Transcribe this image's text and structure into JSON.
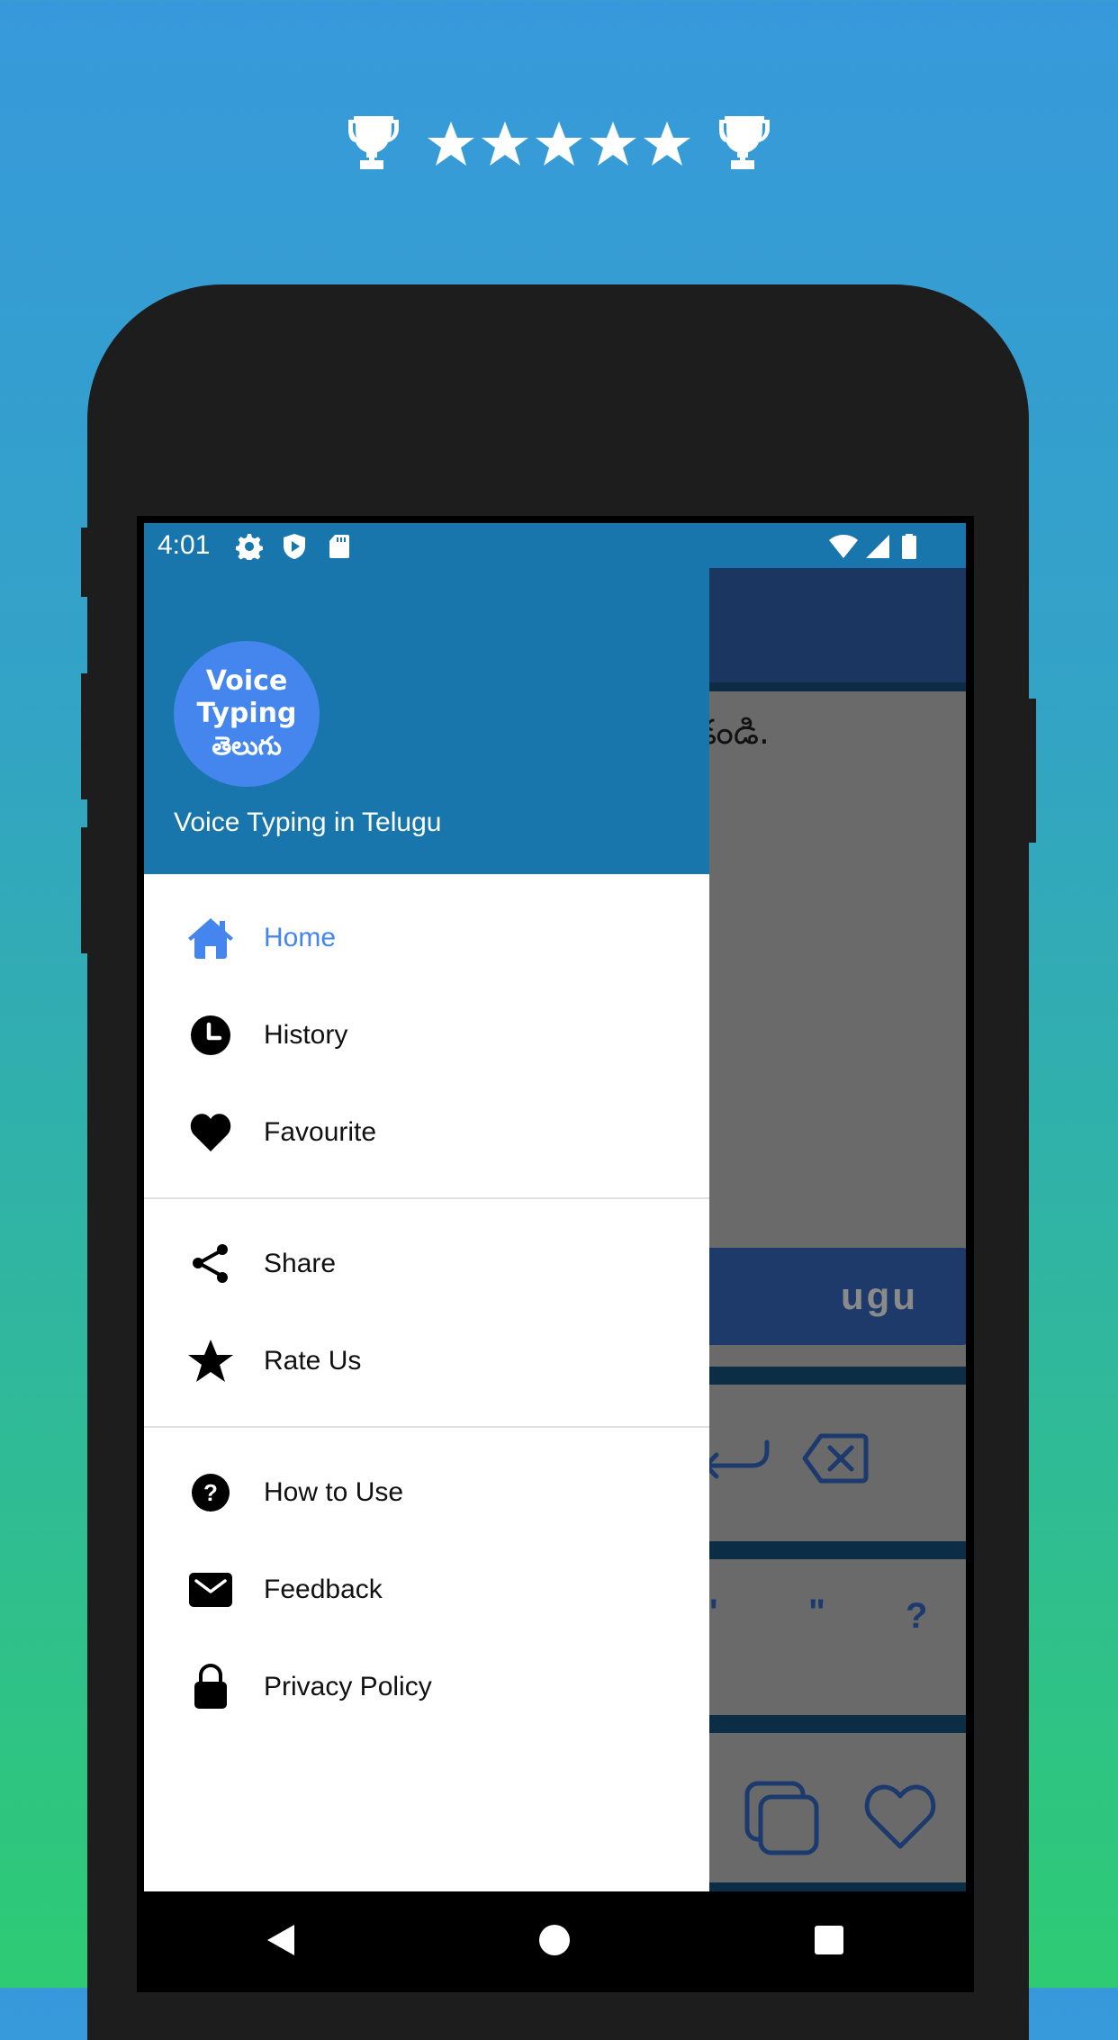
{
  "promo": {
    "rating_stars": 5,
    "left_icon": "trophy-icon",
    "right_icon": "trophy-icon"
  },
  "status_bar": {
    "time": "4:01",
    "left_icons": [
      "gear-icon",
      "shield-play-icon",
      "sd-card-icon"
    ],
    "right_icons": [
      "wifi-icon",
      "cell-signal-icon",
      "battery-icon"
    ]
  },
  "drawer": {
    "logo": {
      "line1": "Voice",
      "line2": "Typing",
      "line3": "తెలుగు"
    },
    "title": "Voice Typing in Telugu",
    "groups": [
      [
        {
          "label": "Home",
          "icon": "home-icon",
          "active": true
        },
        {
          "label": "History",
          "icon": "clock-icon",
          "active": false
        },
        {
          "label": "Favourite",
          "icon": "heart-icon",
          "active": false
        }
      ],
      [
        {
          "label": "Share",
          "icon": "share-icon",
          "active": false
        },
        {
          "label": "Rate Us",
          "icon": "star-icon",
          "active": false
        }
      ],
      [
        {
          "label": "How to Use",
          "icon": "help-circle-icon",
          "active": false
        },
        {
          "label": "Feedback",
          "icon": "mail-icon",
          "active": false
        },
        {
          "label": "Privacy Policy",
          "icon": "lock-icon",
          "active": false
        }
      ]
    ]
  },
  "background_app": {
    "text_fragment": "డండి.",
    "button_fragment": "ugu",
    "keys": [
      "'",
      "\"",
      "?"
    ]
  },
  "colors": {
    "accent": "#4486ee",
    "header": "#1876ac",
    "toolbar": "#1c3662"
  },
  "nav": {
    "back": "back-icon",
    "home": "home-circle-icon",
    "recents": "recents-icon"
  }
}
